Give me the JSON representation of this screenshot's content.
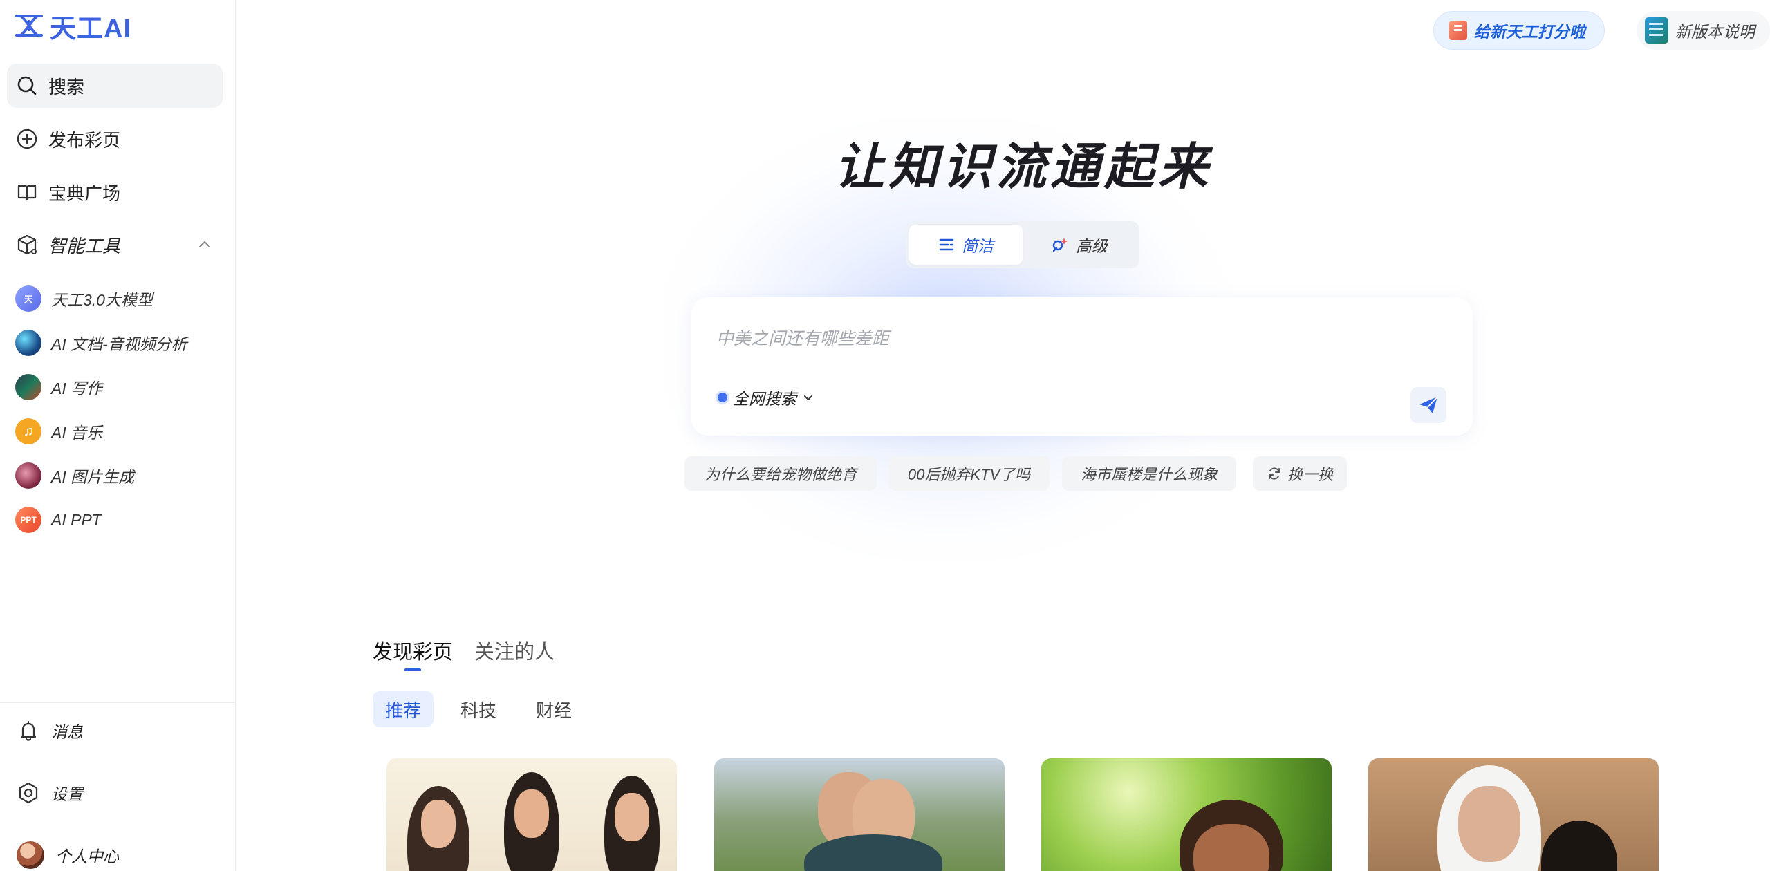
{
  "app": {
    "logo_text": "天工AI",
    "brand_color": "#3d63e0",
    "accent_color": "#2356d6"
  },
  "sidebar": {
    "nav": [
      {
        "label": "搜索",
        "icon": "search-icon",
        "active": true
      },
      {
        "label": "发布彩页",
        "icon": "plus-circle-icon",
        "active": false
      },
      {
        "label": "宝典广场",
        "icon": "book-icon",
        "active": false
      },
      {
        "label": "智能工具",
        "icon": "cube-icon",
        "active": false,
        "expanded": true
      }
    ],
    "tools": [
      {
        "label": "天工3.0大模型",
        "icon": "tiangong-model-icon"
      },
      {
        "label": "AI 文档-音视频分析",
        "icon": "doc-av-analysis-icon"
      },
      {
        "label": "AI 写作",
        "icon": "ai-writing-icon"
      },
      {
        "label": "AI 音乐",
        "icon": "music-note-icon"
      },
      {
        "label": "AI 图片生成",
        "icon": "image-gen-icon"
      },
      {
        "label": "AI PPT",
        "icon": "ppt-icon",
        "badge": "PPT"
      }
    ],
    "bottom": [
      {
        "label": "消息",
        "icon": "bell-icon"
      },
      {
        "label": "设置",
        "icon": "settings-hex-icon"
      },
      {
        "label": "个人中心",
        "icon": "avatar"
      }
    ]
  },
  "header": {
    "rate_button": "给新天工打分啦",
    "release_notes": "新版本说明"
  },
  "hero": {
    "title": "让知识流通起来",
    "modes": [
      {
        "label": "简洁",
        "active": true
      },
      {
        "label": "高级",
        "active": false
      }
    ]
  },
  "search": {
    "placeholder": "中美之间还有哪些差距",
    "value": "",
    "scope": "全网搜索"
  },
  "suggestions": [
    "为什么要给宠物做绝育",
    "00后抛弃KTV了吗",
    "海市蜃楼是什么现象"
  ],
  "refresh_label": "换一换",
  "feed": {
    "tabs": [
      {
        "label": "发现彩页",
        "active": true
      },
      {
        "label": "关注的人",
        "active": false
      }
    ],
    "categories": [
      {
        "label": "推荐",
        "active": true
      },
      {
        "label": "科技",
        "active": false
      },
      {
        "label": "财经",
        "active": false
      }
    ]
  }
}
